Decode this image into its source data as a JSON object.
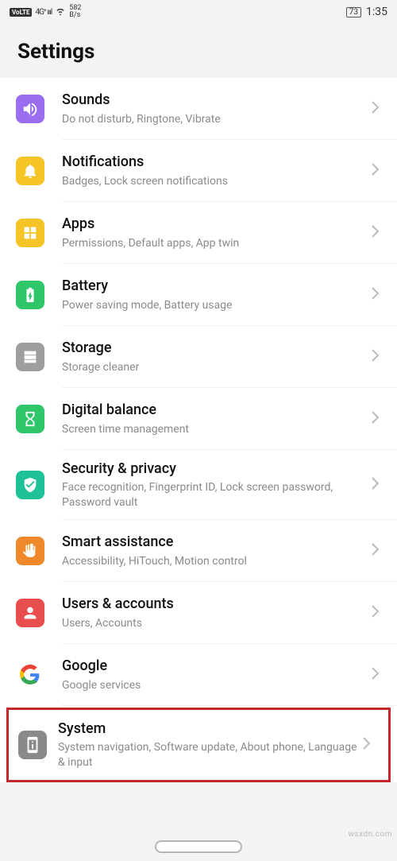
{
  "status": {
    "volte": "VoLTE",
    "signal_gen": "4G⁺",
    "net_speed_top": "582",
    "net_speed_bot": "B/s",
    "battery": "73",
    "time": "1:35"
  },
  "header": {
    "title": "Settings"
  },
  "rows": [
    {
      "id": "sounds",
      "title": "Sounds",
      "sub": "Do not disturb, Ringtone, Vibrate",
      "bg": "bg-purple",
      "icon": "sound"
    },
    {
      "id": "notifications",
      "title": "Notifications",
      "sub": "Badges, Lock screen notifications",
      "bg": "bg-yellow",
      "icon": "bell"
    },
    {
      "id": "apps",
      "title": "Apps",
      "sub": "Permissions, Default apps, App twin",
      "bg": "bg-yellow",
      "icon": "grid"
    },
    {
      "id": "battery",
      "title": "Battery",
      "sub": "Power saving mode, Battery usage",
      "bg": "bg-green",
      "icon": "battery"
    },
    {
      "id": "storage",
      "title": "Storage",
      "sub": "Storage cleaner",
      "bg": "bg-gray",
      "icon": "storage"
    },
    {
      "id": "digital-balance",
      "title": "Digital balance",
      "sub": "Screen time management",
      "bg": "bg-green",
      "icon": "hourglass"
    },
    {
      "id": "security",
      "title": "Security & privacy",
      "sub": "Face recognition, Fingerprint ID, Lock screen password, Password vault",
      "bg": "bg-teal",
      "icon": "shield"
    },
    {
      "id": "smart-assistance",
      "title": "Smart assistance",
      "sub": "Accessibility, HiTouch, Motion control",
      "bg": "bg-orange",
      "icon": "hand"
    },
    {
      "id": "users",
      "title": "Users & accounts",
      "sub": "Users, Accounts",
      "bg": "bg-red",
      "icon": "user"
    },
    {
      "id": "google",
      "title": "Google",
      "sub": "Google services",
      "bg": "bg-white",
      "icon": "google"
    },
    {
      "id": "system",
      "title": "System",
      "sub": "System navigation, Software update, About phone, Language & input",
      "bg": "bg-dgray",
      "icon": "phone",
      "highlighted": true
    }
  ],
  "watermark": "wsxdn.com"
}
